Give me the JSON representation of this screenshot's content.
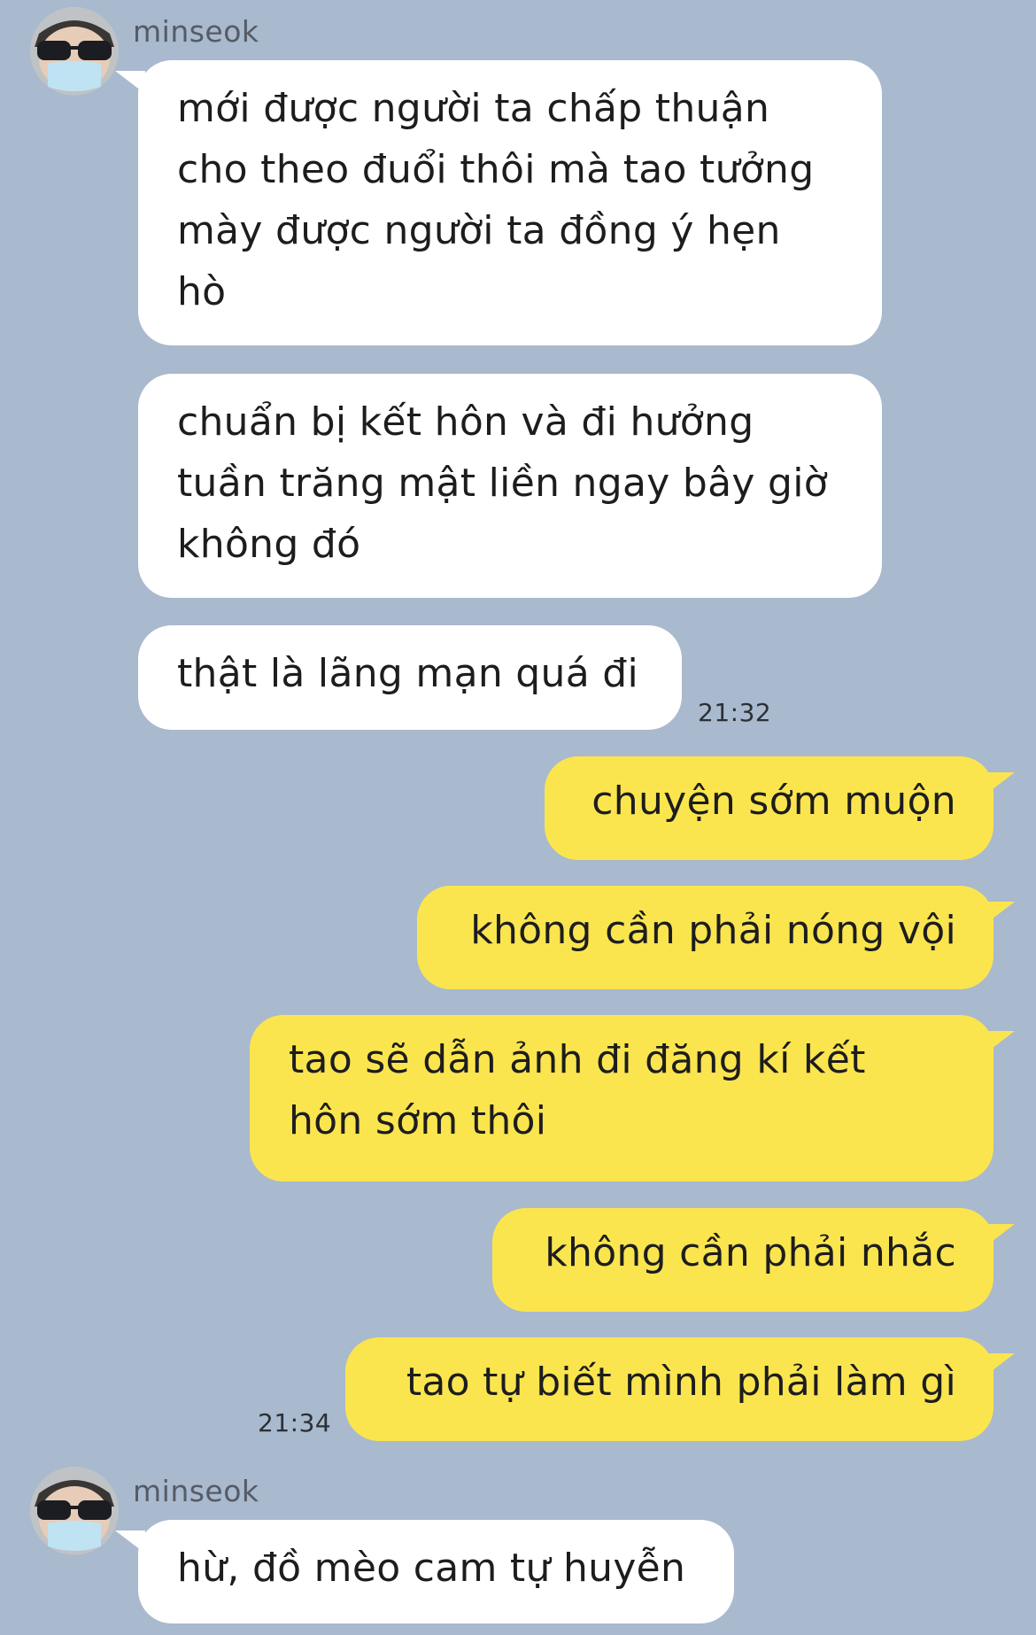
{
  "thread": {
    "messages": [
      {
        "text": "mới được người ta chấp thuận\ncho theo đuổi thôi mà tao tưởng\nmày được người ta đồng ý hẹn\nhò"
      },
      {
        "text": "chuẩn bị kết hôn và đi hưởng\ntuần trăng mật liền ngay bây giờ\nkhông đó"
      },
      {
        "text": "thật là lãng mạn quá đi"
      },
      {
        "text": "chuyện sớm muộn"
      },
      {
        "text": "không cần phải nóng vội"
      },
      {
        "text": "tao sẽ dẫn ảnh đi đăng kí kết\nhôn sớm thôi"
      },
      {
        "text": "không cần phải nhắc"
      },
      {
        "text": "tao tự biết mình phải làm gì"
      },
      {
        "text": "hừ, đồ mèo cam tự huyễn"
      }
    ],
    "sender_names": [
      "minseok",
      "minseok"
    ],
    "timestamps": [
      "21:32",
      "21:34"
    ]
  },
  "colors": {
    "background": "#a9b9ce",
    "incoming_bubble": "#ffffff",
    "outgoing_bubble": "#fbe54e"
  },
  "icons": [
    "avatar-icon"
  ]
}
